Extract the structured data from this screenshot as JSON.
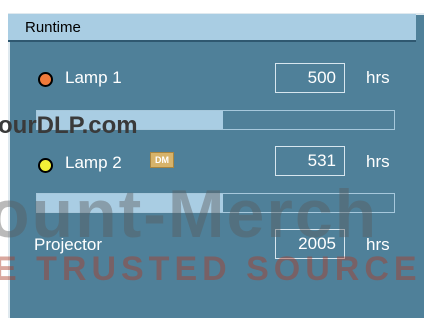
{
  "title": "Runtime",
  "rows": [
    {
      "label": "Lamp 1",
      "led_color": "#f07a3a",
      "value": "500",
      "unit": "hrs",
      "usage_fraction": 0.52
    },
    {
      "label": "Lamp 2",
      "led_color": "#f2f238",
      "value": "531",
      "unit": "hrs",
      "usage_fraction": 0.52
    },
    {
      "label": "Projector",
      "value": "2005",
      "unit": "hrs"
    }
  ],
  "watermark": {
    "site": "ourDLP.com",
    "logo_text": "DM",
    "big_text": "ount-Merch",
    "tagline": "E TRUSTED SOURCE FO"
  },
  "colors": {
    "panel_bg": "#4f8099",
    "title_bg": "#a9cde3",
    "bar_fill": "#a9cde3"
  }
}
